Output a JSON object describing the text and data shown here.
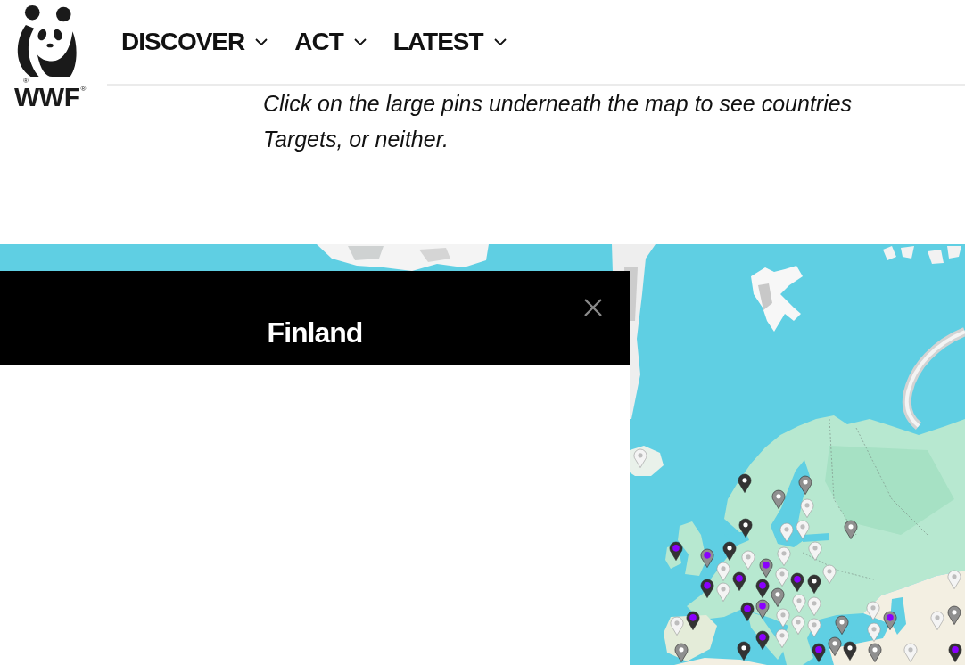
{
  "header": {
    "logo": {
      "registered_marks": [
        "®",
        "®"
      ],
      "wordmark": "WWF"
    },
    "nav": [
      {
        "label": "DISCOVER"
      },
      {
        "label": "ACT"
      },
      {
        "label": "LATEST"
      }
    ]
  },
  "intro": {
    "lines": [
      "Click on the large pins underneath the map to see countries",
      "Targets, or neither."
    ]
  },
  "map": {
    "pins": [
      {
        "color": "#f4f4f4",
        "kind": "plain"
      },
      {
        "color": "#333333",
        "kind": "plain"
      },
      {
        "color": "#8f8f8f",
        "kind": "plain"
      },
      {
        "color": "#8f8f8f",
        "kind": "plain"
      },
      {
        "color": "#f4f4f4",
        "kind": "plain"
      },
      {
        "color": "#333333",
        "kind": "plain"
      },
      {
        "color": "#8f8f8f",
        "kind": "plain"
      },
      {
        "color": "#f4f4f4",
        "kind": "plain"
      },
      {
        "color": "#f4f4f4",
        "kind": "plain"
      },
      {
        "color": "#f4f4f4",
        "kind": "plain"
      },
      {
        "color": "#333333",
        "kind": "dot"
      },
      {
        "color": "#333333",
        "kind": "plain"
      },
      {
        "color": "#f4f4f4",
        "kind": "plain"
      },
      {
        "color": "#8f8f8f",
        "kind": "dot"
      },
      {
        "color": "#f4f4f4",
        "kind": "plain"
      },
      {
        "color": "#f4f4f4",
        "kind": "plain"
      },
      {
        "color": "#8f8f8f",
        "kind": "dot"
      },
      {
        "color": "#333333",
        "kind": "dot"
      },
      {
        "color": "#f4f4f4",
        "kind": "plain"
      },
      {
        "color": "#f4f4f4",
        "kind": "plain"
      },
      {
        "color": "#333333",
        "kind": "dot"
      },
      {
        "color": "#333333",
        "kind": "dot"
      },
      {
        "color": "#333333",
        "kind": "plain"
      },
      {
        "color": "#f4f4f4",
        "kind": "plain"
      },
      {
        "color": "#333333",
        "kind": "dot"
      },
      {
        "color": "#f4f4f4",
        "kind": "plain"
      },
      {
        "color": "#f4f4f4",
        "kind": "plain"
      },
      {
        "color": "#8f8f8f",
        "kind": "plain"
      },
      {
        "color": "#f4f4f4",
        "kind": "plain"
      },
      {
        "color": "#8f8f8f",
        "kind": "dot"
      },
      {
        "color": "#f4f4f4",
        "kind": "plain"
      },
      {
        "color": "#f4f4f4",
        "kind": "plain"
      },
      {
        "color": "#333333",
        "kind": "dot"
      },
      {
        "color": "#f4f4f4",
        "kind": "plain"
      },
      {
        "color": "#f4f4f4",
        "kind": "plain"
      },
      {
        "color": "#8f8f8f",
        "kind": "plain"
      },
      {
        "color": "#f4f4f4",
        "kind": "plain"
      },
      {
        "color": "#8f8f8f",
        "kind": "dot"
      },
      {
        "color": "#f4f4f4",
        "kind": "plain"
      },
      {
        "color": "#333333",
        "kind": "dot"
      },
      {
        "color": "#f4f4f4",
        "kind": "plain"
      },
      {
        "color": "#f4f4f4",
        "kind": "plain"
      },
      {
        "color": "#8f8f8f",
        "kind": "plain"
      },
      {
        "color": "#333333",
        "kind": "dot"
      },
      {
        "color": "#8f8f8f",
        "kind": "plain"
      },
      {
        "color": "#333333",
        "kind": "plain"
      },
      {
        "color": "#8f8f8f",
        "kind": "plain"
      },
      {
        "color": "#333333",
        "kind": "dot"
      },
      {
        "color": "#333333",
        "kind": "plain"
      },
      {
        "color": "#333333",
        "kind": "dot"
      },
      {
        "color": "#8f8f8f",
        "kind": "plain"
      },
      {
        "color": "#f4f4f4",
        "kind": "plain"
      }
    ]
  },
  "panel": {
    "title": "Finland"
  }
}
